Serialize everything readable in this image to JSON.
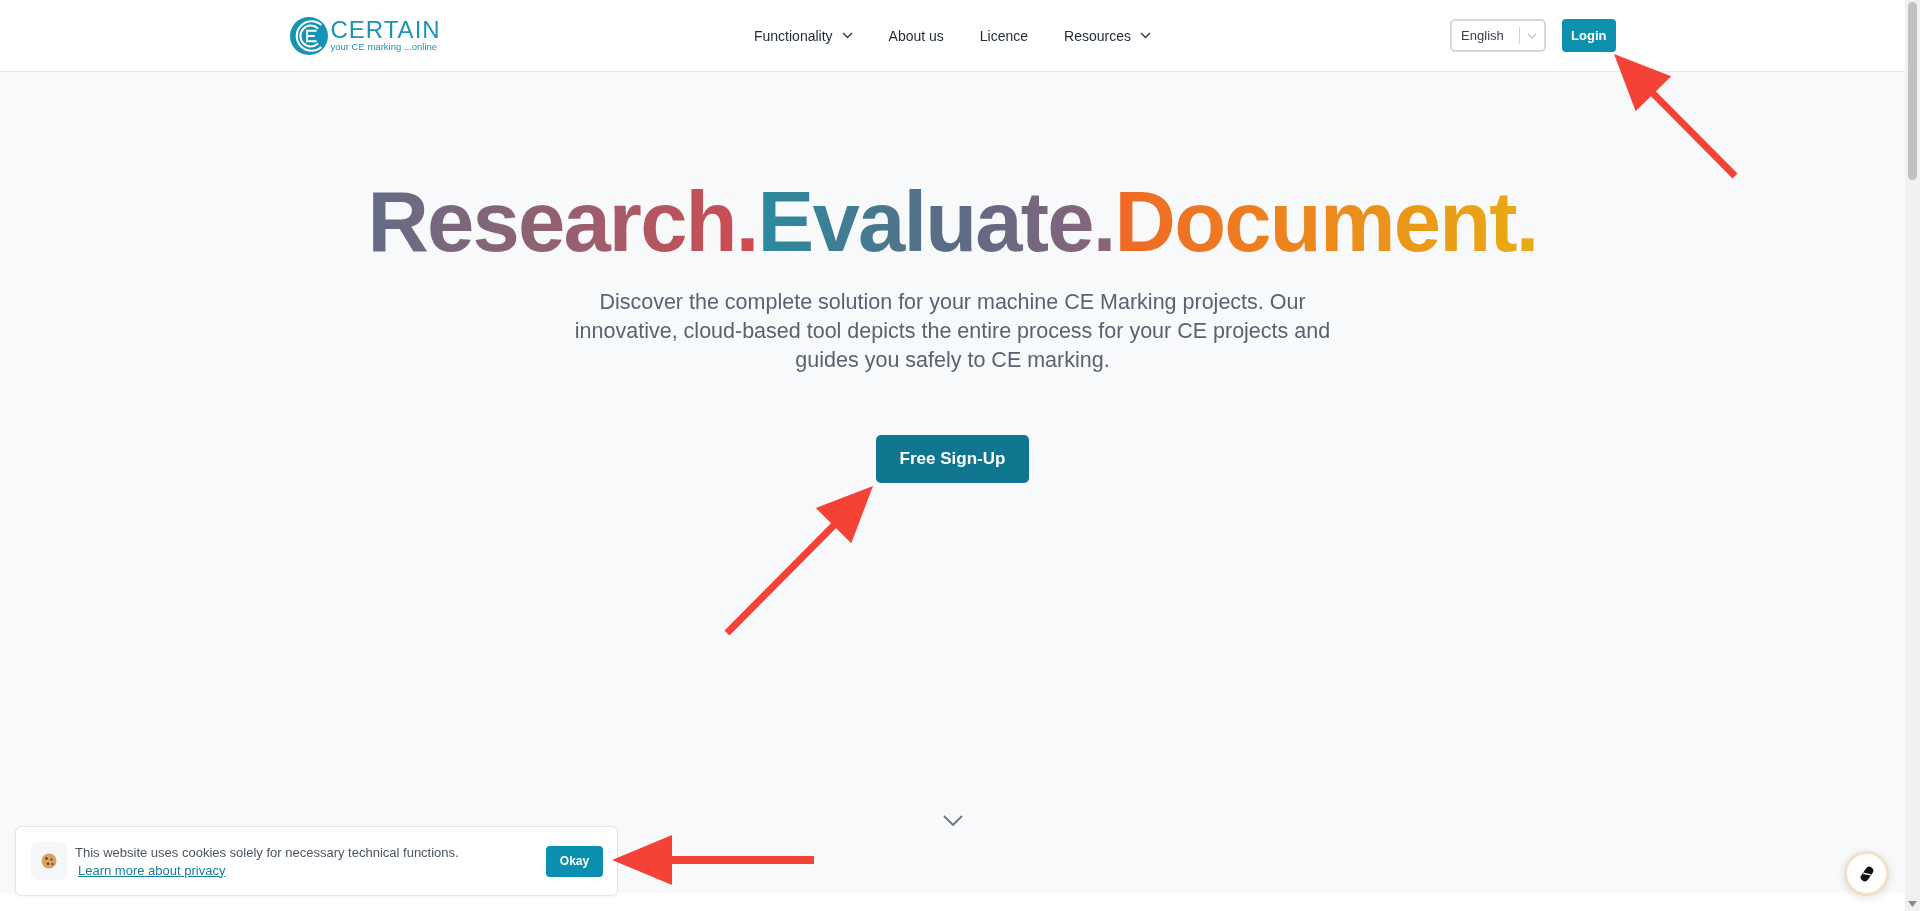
{
  "header": {
    "logo": {
      "name": "CERTAIN",
      "tagline": "your CE marking ...online"
    },
    "nav": [
      {
        "label": "Functionality",
        "has_dropdown": true
      },
      {
        "label": "About us",
        "has_dropdown": false
      },
      {
        "label": "Licence",
        "has_dropdown": false
      },
      {
        "label": "Resources",
        "has_dropdown": true
      }
    ],
    "language_select": {
      "value": "English"
    },
    "login_button": "Login"
  },
  "hero": {
    "headline": [
      "Research.",
      "Evaluate.",
      "Document."
    ],
    "description": "Discover the complete solution for your machine CE Marking projects. Our innovative, cloud-based tool depicts the entire process for your CE projects and guides you safely to CE marking.",
    "cta_button": "Free Sign-Up"
  },
  "cookie_banner": {
    "message": "This website uses cookies solely for necessary technical functions.",
    "link": "Learn more about privacy",
    "button": "Okay"
  }
}
